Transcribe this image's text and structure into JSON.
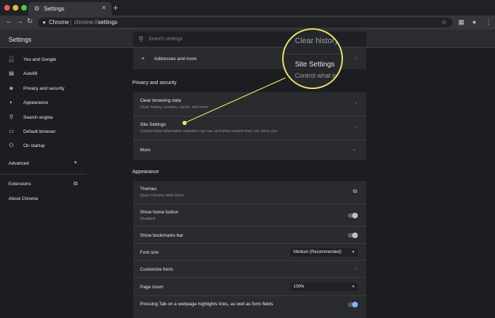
{
  "tab": {
    "title": "Settings",
    "icon": "gear-icon"
  },
  "toolbar": {
    "chip_label": "Chrome",
    "url_scheme": "chrome://",
    "url_path": "settings"
  },
  "header": {
    "title": "Settings",
    "search_placeholder": "Search settings"
  },
  "sidebar": {
    "items": [
      {
        "label": "You and Google",
        "icon": "person-icon"
      },
      {
        "label": "Autofill",
        "icon": "clipboard-icon"
      },
      {
        "label": "Privacy and security",
        "icon": "shield-icon"
      },
      {
        "label": "Appearance",
        "icon": "palette-icon"
      },
      {
        "label": "Search engine",
        "icon": "search-icon"
      },
      {
        "label": "Default browser",
        "icon": "browser-icon"
      },
      {
        "label": "On startup",
        "icon": "power-icon"
      }
    ],
    "advanced": "Advanced",
    "extensions": "Extensions",
    "about": "About Chrome"
  },
  "main": {
    "addresses": "Addresses and more",
    "privacy": {
      "title": "Privacy and security",
      "clear": {
        "title": "Clear browsing data",
        "sub": "Clear history, cookies, cache, and more"
      },
      "site": {
        "title": "Site Settings",
        "sub": "Control what information websites can use and what content they can show you"
      },
      "more": "More"
    },
    "appearance": {
      "title": "Appearance",
      "themes": {
        "title": "Themes",
        "sub": "Open Chrome Web Store"
      },
      "home": {
        "title": "Show home button",
        "sub": "Disabled"
      },
      "bookmarks": "Show bookmarks bar",
      "font_size": {
        "title": "Font size",
        "value": "Medium (Recommended)"
      },
      "customize_fonts": "Customize fonts",
      "page_zoom": {
        "title": "Page zoom",
        "value": "100%"
      },
      "tab_highlight": "Pressing Tab on a webpage highlights links, as well as form fields"
    }
  },
  "magnifier": {
    "top_text": "Clear history",
    "title": "Site Settings",
    "sub": "Control what inf"
  },
  "colors": {
    "accent": "#f0e26a",
    "toggle_on": "#8ab4f8",
    "background": "#1c1d20"
  }
}
